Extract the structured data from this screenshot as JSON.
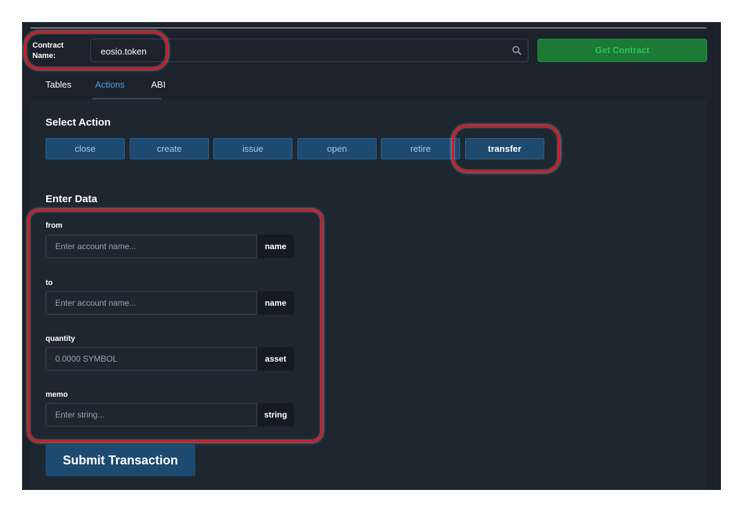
{
  "contract": {
    "label": "Contract Name:",
    "value": "eosio.token",
    "get_button": "Get Contract"
  },
  "tabs": [
    {
      "label": "Tables"
    },
    {
      "label": "Actions"
    },
    {
      "label": "ABI"
    }
  ],
  "actions": {
    "title": "Select Action",
    "items": [
      "close",
      "create",
      "issue",
      "open",
      "retire",
      "transfer"
    ],
    "selected": "transfer"
  },
  "data": {
    "title": "Enter Data",
    "fields": [
      {
        "label": "from",
        "placeholder": "Enter account name...",
        "type": "name"
      },
      {
        "label": "to",
        "placeholder": "Enter account name...",
        "type": "name"
      },
      {
        "label": "quantity",
        "placeholder": "0.0000 SYMBOL",
        "type": "asset"
      },
      {
        "label": "memo",
        "placeholder": "Enter string...",
        "type": "string"
      }
    ]
  },
  "submit_label": "Submit Transaction",
  "colors": {
    "panel_bg": "#1b222b",
    "action_button": "#1d4a71",
    "get_contract_bg": "#1d7a36",
    "active_tab": "#5b9bd8",
    "highlight": "#e0141e"
  }
}
